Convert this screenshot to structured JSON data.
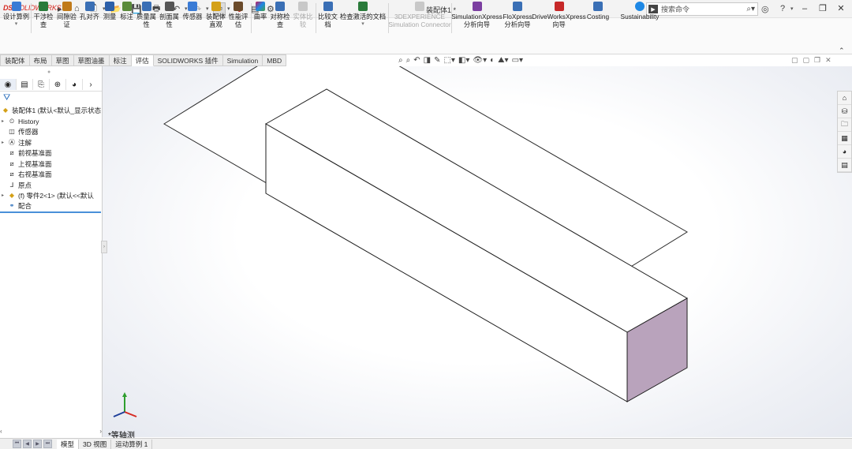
{
  "app": {
    "logo_ds": "DS",
    "logo_text": "SOLIDWORKS",
    "doc_title": "装配体1 *"
  },
  "quickbar": {
    "icons": [
      "home-icon",
      "new-icon",
      "open-icon",
      "save-icon",
      "print-icon",
      "undo-icon",
      "redo-icon",
      "select-icon",
      "rebuild-icon",
      "file-props-icon",
      "options-icon"
    ]
  },
  "search": {
    "placeholder": "搜索命令"
  },
  "window": {
    "minimize": "–",
    "restore": "❐",
    "close": "✕"
  },
  "ribbon": {
    "items": [
      {
        "label": "设计算例",
        "color": "#3a7bd5"
      },
      {
        "label": "干涉检\n查",
        "color": "#2a7a3a"
      },
      {
        "label": "间隙验\n证",
        "color": "#c07a1a"
      },
      {
        "label": "孔对齐",
        "color": "#3a6fb5"
      },
      {
        "label": "测量",
        "color": "#2c5fa8"
      },
      {
        "label": "标注",
        "color": "#5a8a3a"
      },
      {
        "label": "质量属\n性",
        "color": "#3a6fb5"
      },
      {
        "label": "剖面属\n性",
        "color": "#555555"
      },
      {
        "label": "传感器",
        "color": "#3a7bd5"
      },
      {
        "label": "装配体\n直观",
        "color": "#d4a017"
      },
      {
        "label": "性能评\n估",
        "color": "#6a4a2a"
      },
      {
        "label": "曲率",
        "color": "#c2185b"
      },
      {
        "label": "对称检\n查",
        "color": "#3a6fb5"
      },
      {
        "label": "实体比\n较",
        "color": "#a0a0a0",
        "disabled": true
      },
      {
        "label": "比较文\n档",
        "color": "#3a6fb5"
      },
      {
        "label": "检查激活的文档",
        "color": "#2a7a3a"
      },
      {
        "label": "3DEXPERIENCE\nSimulation Connector",
        "color": "#b0b0b0",
        "disabled": true
      },
      {
        "label": "SimulationXpress\n分析向导",
        "color": "#7b3fa0"
      },
      {
        "label": "FloXpress\n分析向导",
        "color": "#3a6fb5"
      },
      {
        "label": "DriveWorksXpress\n向导",
        "color": "#c62828"
      },
      {
        "label": "Costing",
        "color": "#3a6fb5"
      },
      {
        "label": "Sustainability",
        "color": "#1e88e5"
      }
    ]
  },
  "tabs": [
    "装配体",
    "布局",
    "草图",
    "草图油墨",
    "标注",
    "评估",
    "SOLIDWORKS 插件",
    "Simulation",
    "MBD"
  ],
  "active_tab_index": 5,
  "tree": [
    {
      "label": "装配体1  (默认<默认_显示状态",
      "icon": "assembly-icon",
      "caret": ""
    },
    {
      "label": "History",
      "icon": "history-icon",
      "caret": "▸"
    },
    {
      "label": "传感器",
      "icon": "sensor-icon",
      "caret": ""
    },
    {
      "label": "注解",
      "icon": "annotation-icon",
      "caret": "▸"
    },
    {
      "label": "前视基准面",
      "icon": "plane-icon",
      "caret": ""
    },
    {
      "label": "上视基准面",
      "icon": "plane-icon",
      "caret": ""
    },
    {
      "label": "右视基准面",
      "icon": "plane-icon",
      "caret": ""
    },
    {
      "label": "原点",
      "icon": "origin-icon",
      "caret": ""
    },
    {
      "label": "(f) 零件2<1> (默认<<默认",
      "icon": "part-icon",
      "caret": "▸"
    },
    {
      "label": "配合",
      "icon": "mates-icon",
      "caret": ""
    }
  ],
  "view": {
    "label": "*等轴测"
  },
  "bottom_tabs": [
    "模型",
    "3D 视图",
    "运动算例 1"
  ],
  "active_bottom_tab_index": 0,
  "colors": {
    "end_face": "#b9a3bc",
    "accent": "#4a90d9"
  }
}
